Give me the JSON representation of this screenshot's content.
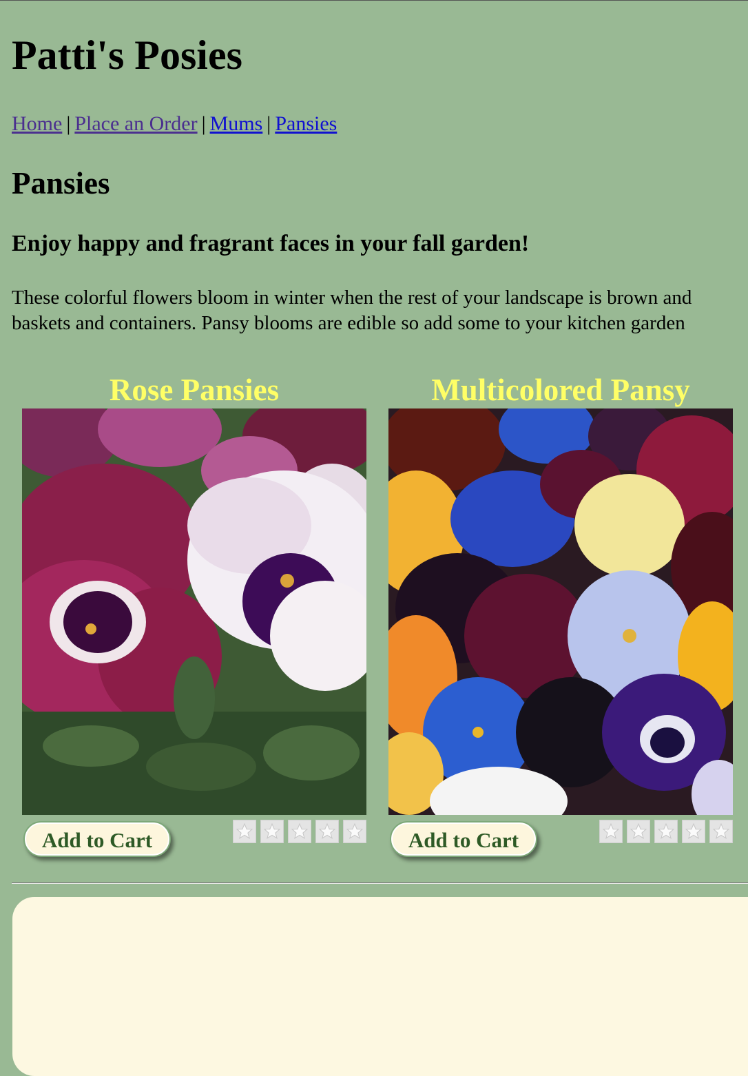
{
  "site": {
    "title": "Patti's Posies"
  },
  "nav": {
    "items": [
      {
        "label": "Home",
        "state": "visited"
      },
      {
        "label": "Place an Order",
        "state": "visited"
      },
      {
        "label": "Mums",
        "state": "unvisited"
      },
      {
        "label": "Pansies",
        "state": "unvisited"
      }
    ],
    "separator": "|"
  },
  "page": {
    "heading": "Pansies",
    "tagline": "Enjoy happy and fragrant faces in your fall garden!",
    "intro_line1": "These colorful flowers bloom in winter when the rest of your landscape is brown and",
    "intro_line2": "baskets and containers. Pansy blooms are edible so add some to your kitchen garden"
  },
  "products": [
    {
      "title": "Rose Pansies",
      "button_label": "Add to Cart",
      "rating": 0,
      "rating_max": 5
    },
    {
      "title": "Multicolored Pansy",
      "button_label": "Add to Cart",
      "rating": 0,
      "rating_max": 5
    }
  ],
  "colors": {
    "background": "#99b994",
    "product_title": "#ffff66",
    "button_text": "#2e5a26",
    "button_bg": "#fdf6dd",
    "footer_panel": "#fdf8e1",
    "link_visited": "#4b2f8f",
    "link_unvisited": "#1010d0"
  }
}
